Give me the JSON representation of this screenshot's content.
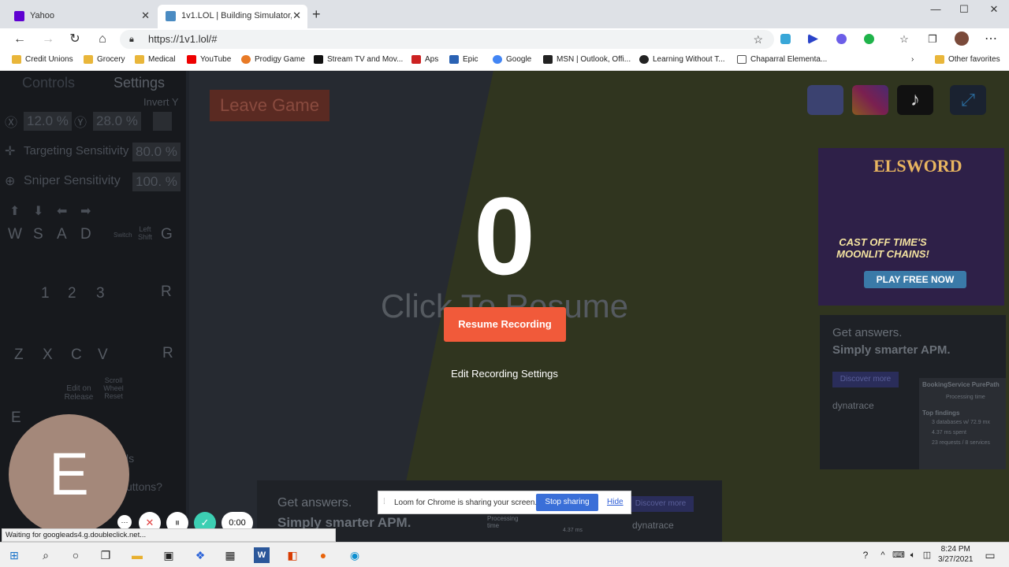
{
  "tabs": [
    {
      "title": "Yahoo",
      "active": false
    },
    {
      "title": "1v1.LOL | Building Simulator, Bat",
      "active": true
    }
  ],
  "window": {
    "minimize": "—",
    "maximize": "☐",
    "close": "✕",
    "newtab": "+"
  },
  "address": {
    "url": "https://1v1.lol/#"
  },
  "bookmarks": [
    "Credit Unions",
    "Grocery",
    "Medical",
    "YouTube",
    "Prodigy Game",
    "Stream TV and Mov...",
    "Aps",
    "Epic",
    "Google",
    "MSN | Outlook, Offi...",
    "Learning Without T...",
    "Chaparral Elementa...",
    "Other favorites"
  ],
  "game": {
    "tabs": {
      "controls": "Controls",
      "settings": "Settings"
    },
    "invert_y": "Invert Y",
    "x_sens": "12.0 %",
    "y_sens": "28.0 %",
    "targeting_label": "Targeting Sensitivity",
    "targeting_value": "80.0 %",
    "sniper_label": "Sniper Sensitivity",
    "sniper_value": "100. %",
    "keys_row1": [
      "W",
      "S",
      "A",
      "D"
    ],
    "switch": "Switch",
    "left_shift": "Left Shift",
    "g": "G",
    "slots": [
      "1",
      "2",
      "3"
    ],
    "r": "R",
    "build_keys": [
      "Z",
      "X",
      "C",
      "V"
    ],
    "r2": "R",
    "edit_on_release": "Edit on Release",
    "scroll_wheel_reset": "Scroll Wheel Reset",
    "e": "E",
    "leave_game": "Leave Game",
    "score": "0",
    "click_to_resume": "Click To Resume",
    "resume_recording": "Resume Recording",
    "edit_recording_settings": "Edit Recording Settings",
    "partial_text_1": "ls",
    "partial_text_2": "uttons?"
  },
  "ads": {
    "elsword_title": "ELSWORD",
    "elsword_tagline": "CAST OFF TIME'S MOONLIT CHAINS!",
    "elsword_cta": "PLAY FREE NOW",
    "dyna_q": "Get answers.",
    "dyna_a": "Simply smarter APM.",
    "dyna_cta": "Discover more",
    "dyna_brand": "dynatrace",
    "panel_title": "BookingService PurePath",
    "panel_processing": "Processing time",
    "panel_top": "Top findings",
    "panel_f1": "3 databases w/ 72.9 mx",
    "panel_f2": "4.37 ms spent",
    "panel_f3": "23 requests / 8 services",
    "bottom_q": "Get answers.",
    "bottom_a": "Simply smarter APM.",
    "bottom_processing": "Processing time",
    "bottom_ms": "4.37 ms",
    "bottom_cta": "Discover more",
    "bottom_brand": "dynatrace"
  },
  "loom": {
    "message": "Loom for Chrome is sharing your screen.",
    "stop": "Stop sharing",
    "hide": "Hide"
  },
  "recorder": {
    "avatar_letter": "E",
    "more": "···",
    "cancel": "✕",
    "pause": "⏸",
    "done": "✓",
    "timer": "0:00"
  },
  "status_bar": "Waiting for googleads4.g.doubleclick.net...",
  "taskbar": {
    "time": "8:24 PM",
    "date": "3/27/2021"
  },
  "colors": {
    "accent": "#f15a3a",
    "loom_blue": "#3a6fd8",
    "check": "#3ccfb3"
  }
}
